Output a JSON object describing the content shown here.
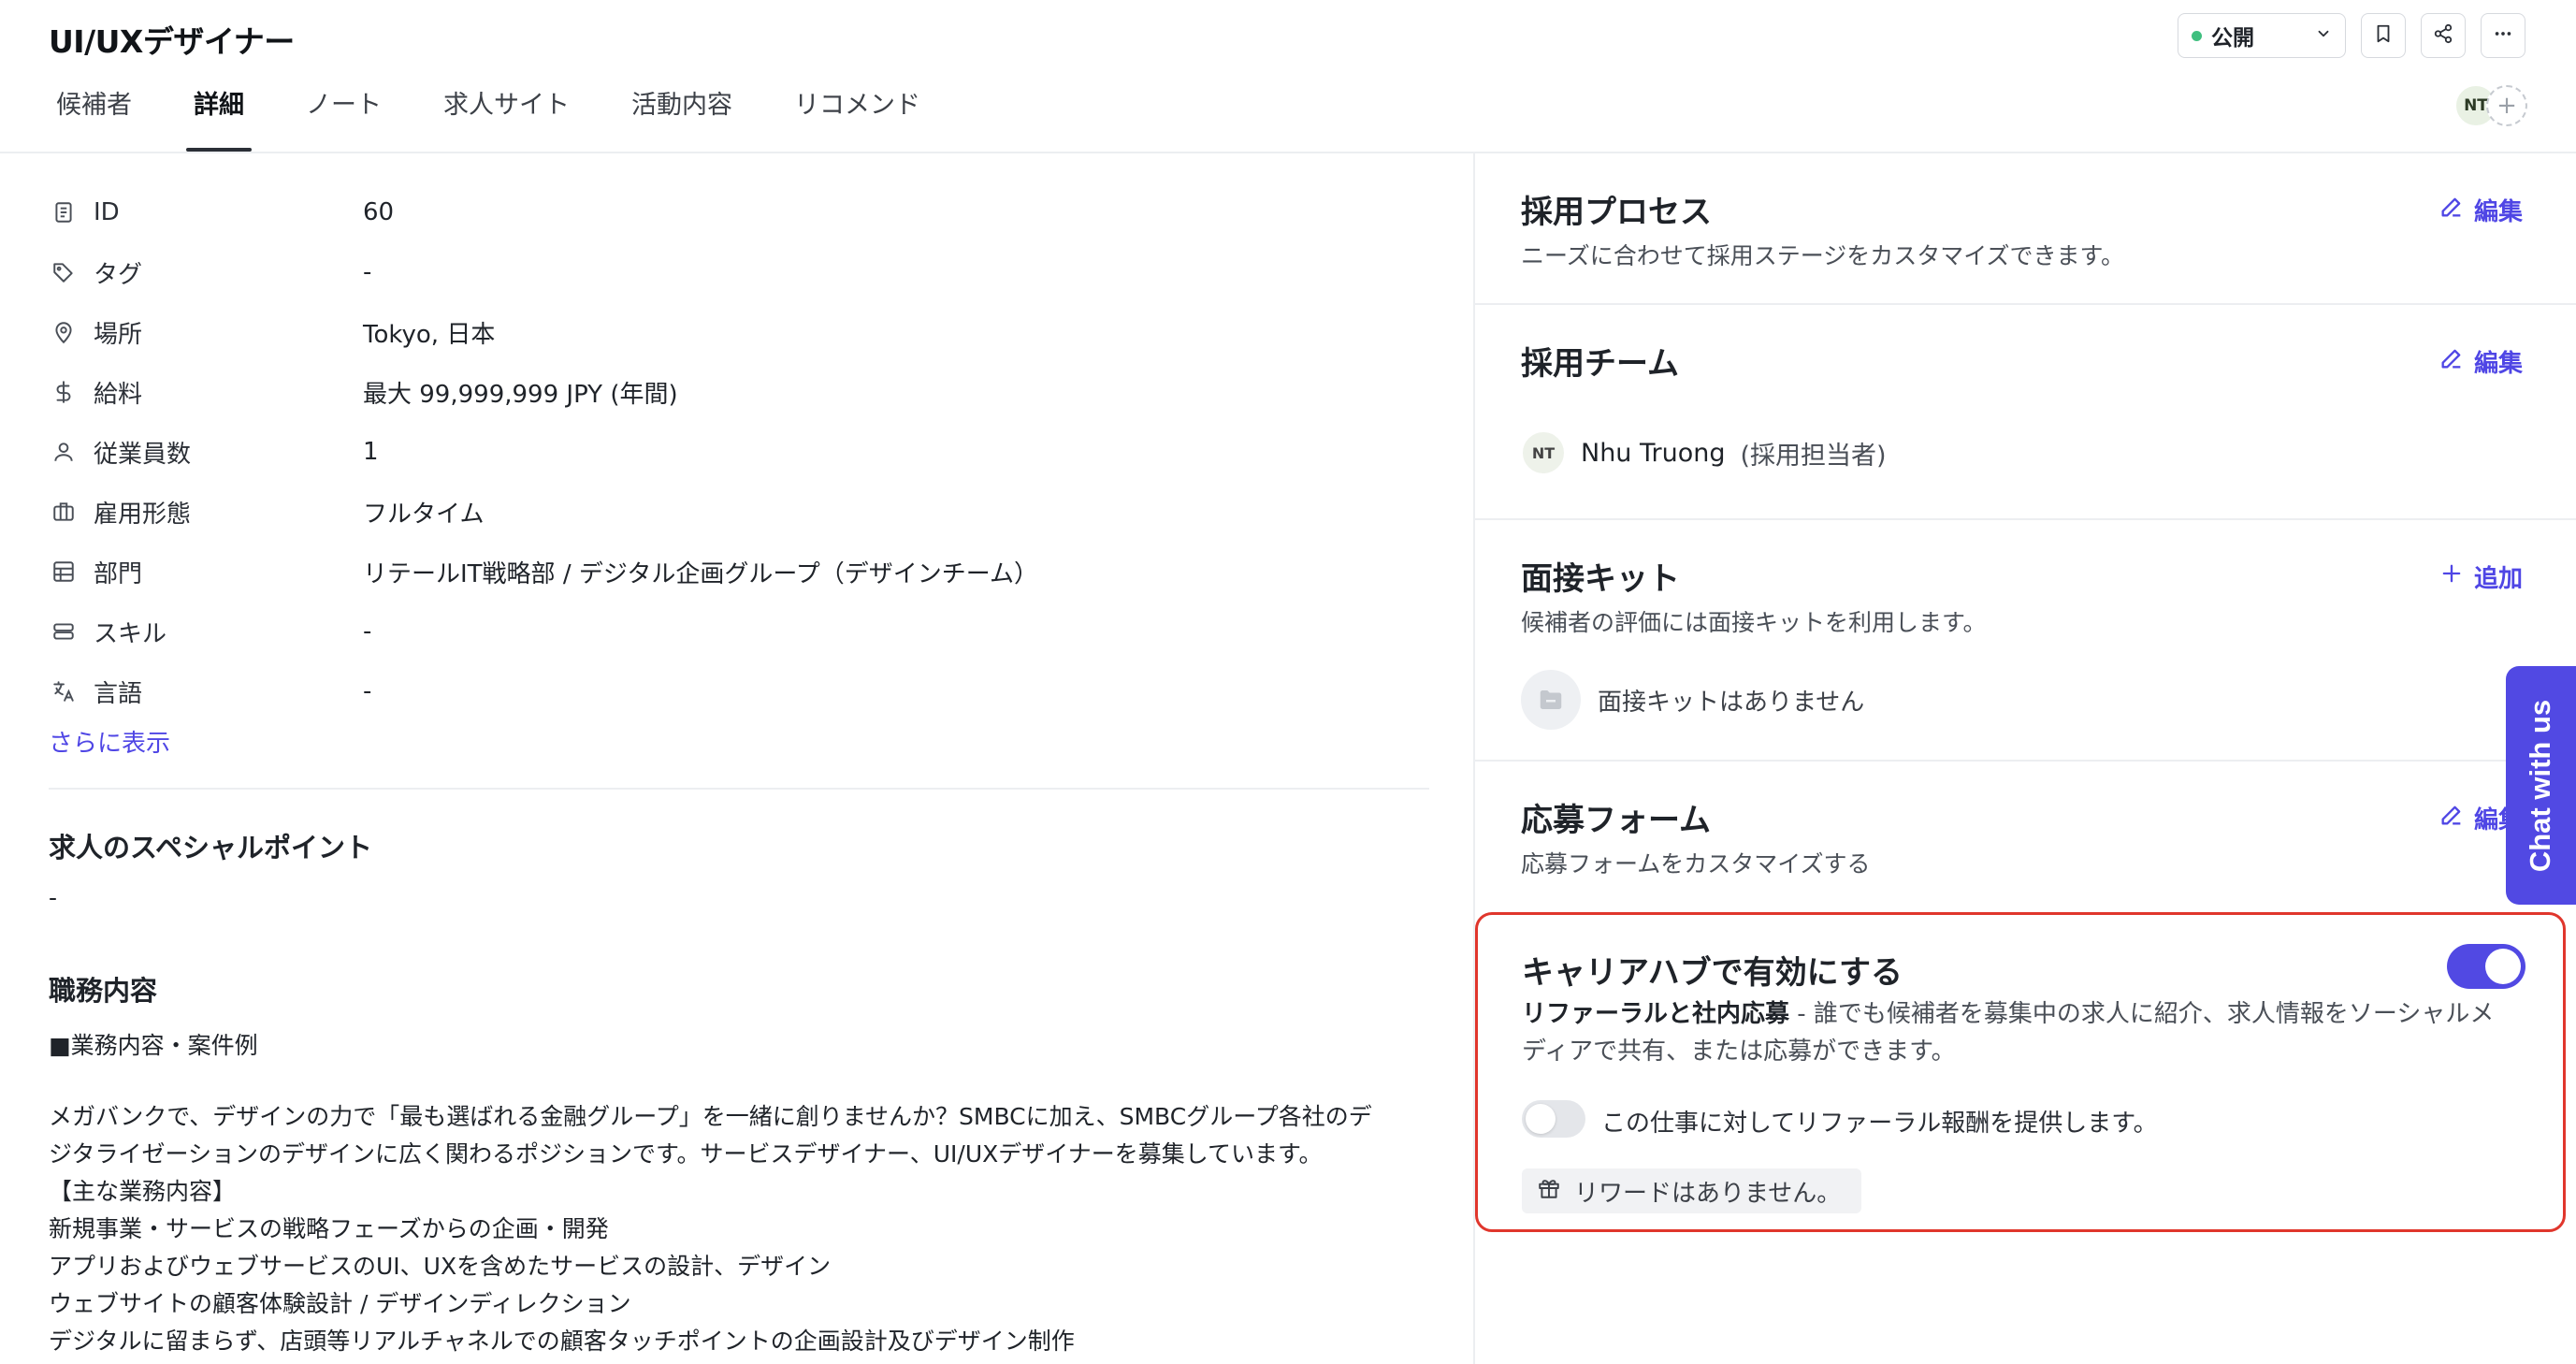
{
  "header": {
    "title": "UI/UXデザイナー",
    "status": "公開",
    "tabs": [
      {
        "label": "候補者"
      },
      {
        "label": "詳細",
        "active": true
      },
      {
        "label": "ノート"
      },
      {
        "label": "求人サイト"
      },
      {
        "label": "活動内容"
      },
      {
        "label": "リコメンド"
      }
    ],
    "avatar_initials": "NT"
  },
  "details": {
    "fields": [
      {
        "icon": "id-card-icon",
        "label": "ID",
        "value": "60"
      },
      {
        "icon": "tag-icon",
        "label": "タグ",
        "value": "-"
      },
      {
        "icon": "location-pin-icon",
        "label": "場所",
        "value": "Tokyo, 日本"
      },
      {
        "icon": "dollar-icon",
        "label": "給料",
        "value": "最大 99,999,999 JPY (年間)"
      },
      {
        "icon": "user-icon",
        "label": "従業員数",
        "value": "1"
      },
      {
        "icon": "briefcase-icon",
        "label": "雇用形態",
        "value": "フルタイム"
      },
      {
        "icon": "table-icon",
        "label": "部門",
        "value": "リテールIT戦略部 / デジタル企画グループ（デザインチーム）"
      },
      {
        "icon": "skill-icon",
        "label": "スキル",
        "value": "-"
      },
      {
        "icon": "translate-icon",
        "label": "言語",
        "value": "-"
      }
    ],
    "show_more": "さらに表示",
    "special_points_title": "求人のスペシャルポイント",
    "special_points_value": "-",
    "duties_title": "職務内容",
    "duties_lines": [
      "■業務内容・案件例",
      "メガバンクで、デザインの力で「最も選ばれる金融グループ」を一緒に創りませんか？SMBCに加え、SMBCグループ各社のデ",
      "ジタライゼーションのデザインに広く関わるポジションです。サービスデザイナー、UI/UXデザイナーを募集しています。",
      "【主な業務内容】",
      "新規事業・サービスの戦略フェーズからの企画・開発",
      "アプリおよびウェブサービスのUI、UXを含めたサービスの設計、デザイン",
      "ウェブサイトの顧客体験設計 / デザインディレクション",
      "デジタルに留まらず、店頭等リアルチャネルでの顧客タッチポイントの企画設計及びデザイン制作"
    ]
  },
  "process": {
    "title": "採用プロセス",
    "subtitle": "ニーズに合わせて採用ステージをカスタマイズできます。",
    "action": "編集"
  },
  "team": {
    "title": "採用チーム",
    "action": "編集",
    "member_initials": "NT",
    "member_name": "Nhu Truong",
    "member_role": "(採用担当者)"
  },
  "interview_kit": {
    "title": "面接キット",
    "subtitle": "候補者の評価には面接キットを利用します。",
    "action": "追加",
    "empty": "面接キットはありません"
  },
  "application_form": {
    "title": "応募フォーム",
    "subtitle": "応募フォームをカスタマイズする",
    "action": "編集"
  },
  "career_hub": {
    "title": "キャリアハブで有効にする",
    "enabled": true,
    "desc_bold": "リファーラルと社内応募",
    "desc_rest": " - 誰でも候補者を募集中の求人に紹介、求人情報をソーシャルメディアで共有、または応募ができます。",
    "referral_toggle_on": false,
    "referral_label": "この仕事に対してリファーラル報酬を提供します。",
    "reward_empty": "リワードはありません。"
  },
  "chat_tab": "Chat with us",
  "colors": {
    "accent": "#5149e3",
    "link": "#4f46e5",
    "highlight_border": "#e0362c",
    "status_dot": "#3fbf7f"
  }
}
